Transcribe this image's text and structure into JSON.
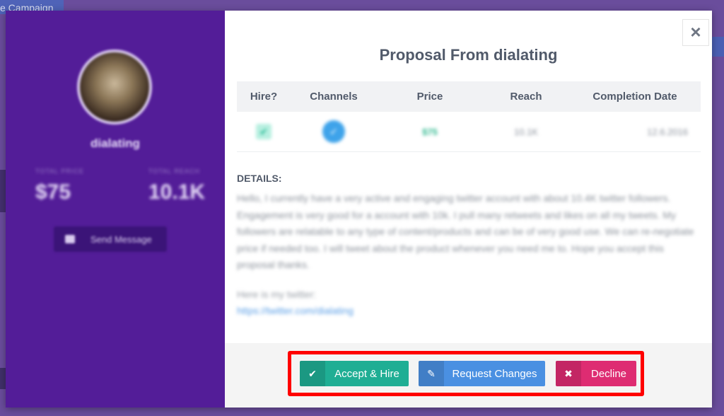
{
  "background": {
    "tab_label": "e Campaign"
  },
  "profile": {
    "username": "dialating",
    "stats": [
      {
        "label": "TOTAL PRICE",
        "value": "$75"
      },
      {
        "label": "TOTAL REACH",
        "value": "10.1K"
      }
    ],
    "send_message_label": "Send Message"
  },
  "modal": {
    "title": "Proposal From dialating",
    "close_icon": "×",
    "table": {
      "headers": [
        "Hire?",
        "Channels",
        "Price",
        "Reach",
        "Completion Date"
      ],
      "row": {
        "hire_icon": "✔",
        "channel_icon": "twitter-icon",
        "price": "$75",
        "reach": "10.1K",
        "completion_date": "12.6.2016"
      }
    },
    "details_heading": "DETAILS:",
    "details_text": "Hello, I currently have a very active and engaging twitter account with about 10.4K twitter followers. Engagement is very good for a account with 10k. I pull many retweets and likes on all my tweets. My followers are relatable to any type of content/products and can be of very good use. We can re-negotiate price if needed too. I will tweet about the product whenever you need me to. Hope you accept this proposal thanks.",
    "twitter_intro": "Here is my twitter:",
    "twitter_link": "https://twitter.com/dialating"
  },
  "actions": {
    "accept_label": "Accept & Hire",
    "request_label": "Request Changes",
    "decline_label": "Decline",
    "accept_icon": "✔",
    "request_icon": "✎",
    "decline_icon": "✖"
  },
  "colors": {
    "profile_bg": "#531d98",
    "accept": "#1fae94",
    "request": "#4a90e2",
    "decline": "#de2c72",
    "highlight": "#ff0000"
  }
}
